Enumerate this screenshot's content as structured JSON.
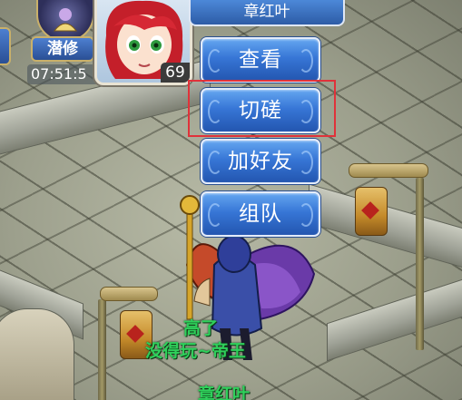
{
  "hud": {
    "skill_label": "潜修",
    "clock": "07:51:5"
  },
  "target": {
    "name": "章红叶",
    "level": "69"
  },
  "menu": [
    {
      "label": "查看"
    },
    {
      "label": "切磋"
    },
    {
      "label": "加好友"
    },
    {
      "label": "组队"
    }
  ],
  "scene_labels": {
    "title_partial": "高了",
    "player_title": "没得玩~帝王",
    "player_name": "章红叶"
  },
  "colors": {
    "button_blue": "#3776d6",
    "highlight": "#e0323a",
    "name_green": "#2fd05b"
  }
}
